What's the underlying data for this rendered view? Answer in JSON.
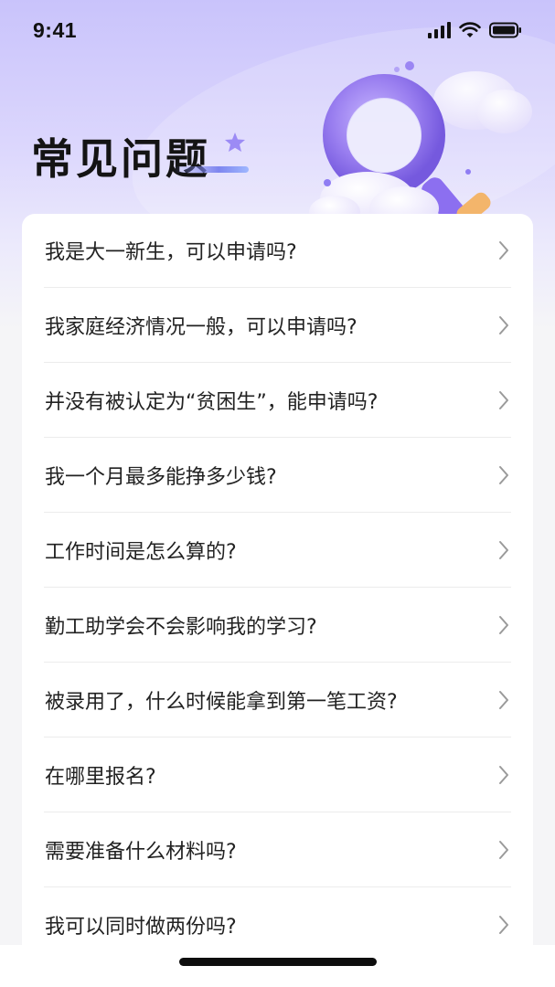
{
  "status_bar": {
    "time": "9:41",
    "icons": [
      "signal-icon",
      "wifi-icon",
      "battery-icon"
    ]
  },
  "header": {
    "title": "常见问题"
  },
  "faq": {
    "items": [
      {
        "question": "我是大一新生，可以申请吗?"
      },
      {
        "question": "我家庭经济情况一般，可以申请吗?"
      },
      {
        "question": "并没有被认定为“贫困生”，能申请吗?"
      },
      {
        "question": "我一个月最多能挣多少钱?"
      },
      {
        "question": "工作时间是怎么算的?"
      },
      {
        "question": "勤工助学会不会影响我的学习?"
      },
      {
        "question": "被录用了，什么时候能拿到第一笔工资?"
      },
      {
        "question": "在哪里报名?"
      },
      {
        "question": "需要准备什么材料吗?"
      },
      {
        "question": "我可以同时做两份吗?"
      }
    ]
  },
  "colors": {
    "accent": "#8f7df3",
    "hero_top": "#c9c3fb",
    "background": "#f5f5f7",
    "card": "#ffffff",
    "text": "#222222",
    "chevron": "#9a9a9a"
  }
}
